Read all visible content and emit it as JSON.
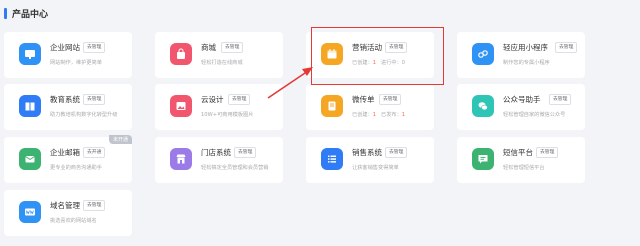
{
  "section": {
    "title": "产品中心"
  },
  "cards": [
    {
      "name": "企业网站",
      "tag": "去管理",
      "desc": "网站制作，维护更简单",
      "icon": "monitor-icon",
      "color": "#2f93f5"
    },
    {
      "name": "商城",
      "tag": "去管理",
      "desc": "轻松打造在线商城",
      "icon": "shopping-bag-icon",
      "color": "#f2566e"
    },
    {
      "name": "营销活动",
      "tag": "去管理",
      "created_label": "已创建：",
      "created": "1",
      "running_label": "进行中：",
      "running": "0",
      "icon": "calendar-icon",
      "color": "#f5a623"
    },
    {
      "name": "轻应用小程序",
      "tag": "去管理",
      "desc": "制作您的专属小程序",
      "icon": "mini-program-icon",
      "color": "#2f93f5"
    },
    {
      "name": "教育系统",
      "tag": "去管理",
      "desc": "助力教培机构数字化转型升级",
      "icon": "book-icon",
      "color": "#2f7cf6"
    },
    {
      "name": "云设计",
      "tag": "去管理",
      "desc": "10W+可商用模板图片",
      "icon": "image-icon",
      "color": "#f2566e"
    },
    {
      "name": "微传单",
      "tag": "去管理",
      "created_label": "已创建：",
      "created": "1",
      "published_label": "已发布：",
      "published": "1",
      "icon": "flyer-icon",
      "color": "#f5a623"
    },
    {
      "name": "公众号助手",
      "tag": "去管理",
      "desc": "轻松管理自家的微信公众号",
      "icon": "wechat-icon",
      "color": "#2ec4b6"
    },
    {
      "name": "企业邮箱",
      "tag": "去开通",
      "desc": "更专业的商务沟通助手",
      "badge": "未开通",
      "icon": "mail-icon",
      "color": "#3cb371"
    },
    {
      "name": "门店系统",
      "tag": "去管理",
      "desc": "轻松搞定全员管理和会员营销",
      "icon": "store-icon",
      "color": "#9b7be8"
    },
    {
      "name": "销售系统",
      "tag": "去管理",
      "desc": "让获客销售变得简单",
      "icon": "list-icon",
      "color": "#2f7cf6"
    },
    {
      "name": "短信平台",
      "tag": "去管理",
      "desc": "轻松管理短信平台",
      "icon": "message-icon",
      "color": "#3cb371"
    },
    {
      "name": "域名管理",
      "tag": "去管理",
      "desc": "挑选喜欢的网站域名",
      "icon": "www-icon",
      "color": "#2f93f5"
    }
  ]
}
